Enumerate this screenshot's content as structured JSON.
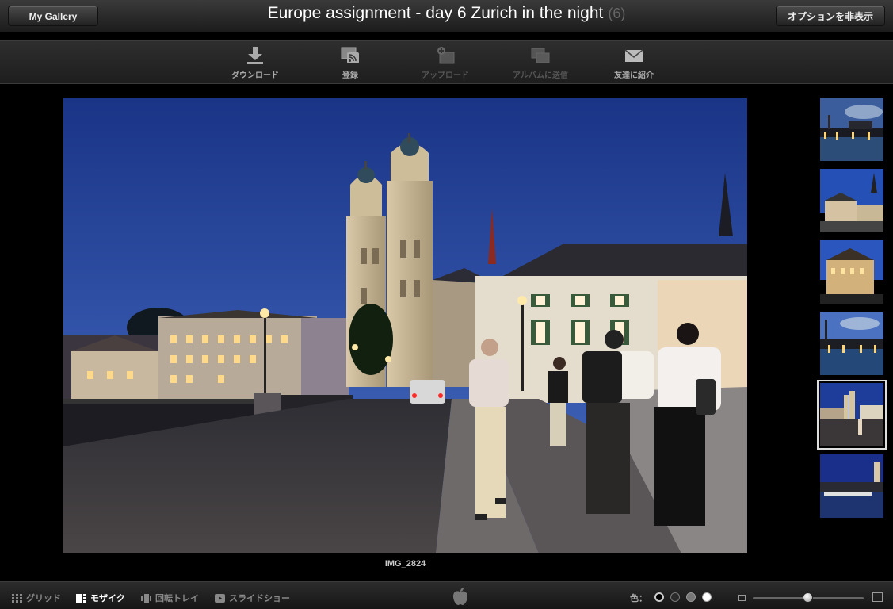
{
  "header": {
    "back_button": "My Gallery",
    "title": "Europe assignment - day 6 Zurich in the night",
    "count": "(6)",
    "options_button": "オプションを非表示"
  },
  "toolbar": {
    "download": "ダウンロード",
    "subscribe": "登録",
    "upload": "アップロード",
    "send_to_album": "アルバムに送信",
    "tell_friend": "友達に紹介"
  },
  "photo": {
    "caption": "IMG_2824"
  },
  "thumbnails": {
    "selected_index": 4,
    "count": 6
  },
  "bottom": {
    "views": {
      "grid": "グリッド",
      "mosaic": "モザイク",
      "carousel": "回転トレイ",
      "slideshow": "スライドショー"
    },
    "active_view": "mosaic",
    "color_label": "色：",
    "colors": [
      "#000000",
      "#333333",
      "#777777",
      "#ffffff"
    ],
    "selected_color": "#000000",
    "thumbnail_size": 0.5
  }
}
